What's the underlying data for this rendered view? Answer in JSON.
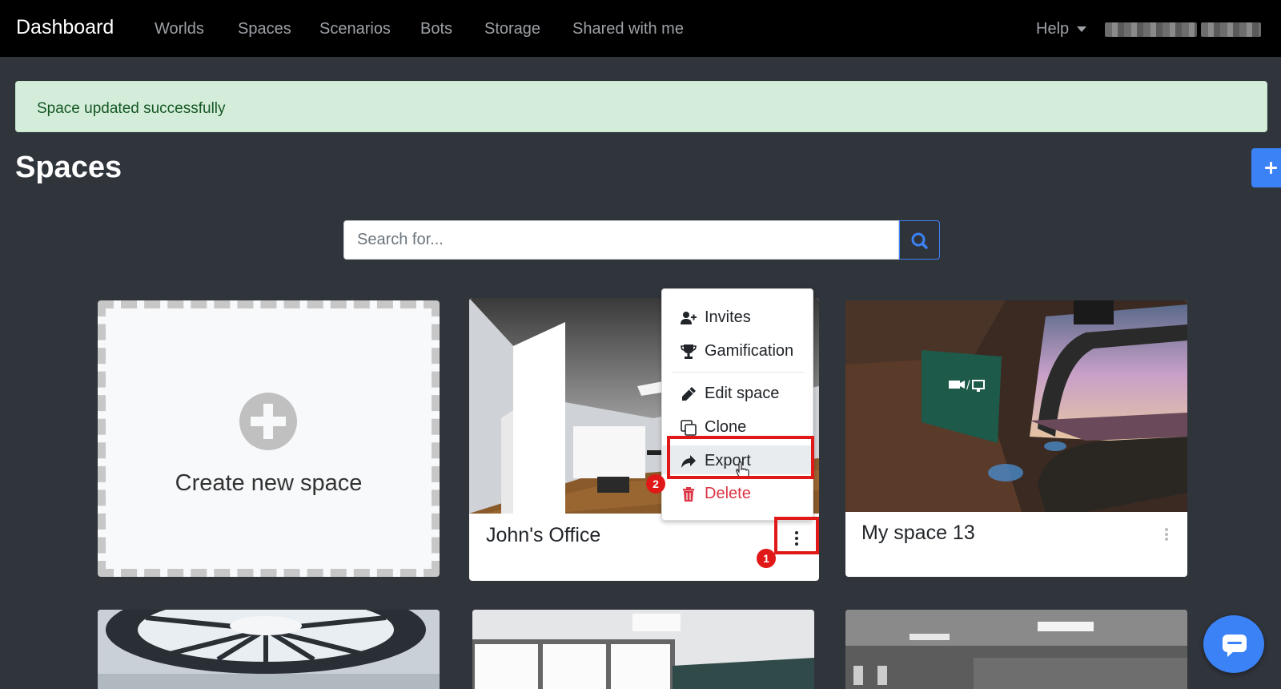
{
  "nav": {
    "brand": "Dashboard",
    "links": [
      "Worlds",
      "Spaces",
      "Scenarios",
      "Bots",
      "Storage",
      "Shared with me"
    ],
    "help": "Help"
  },
  "alert": {
    "text": "Space updated successfully"
  },
  "page": {
    "title": "Spaces"
  },
  "search": {
    "placeholder": "Search for..."
  },
  "create_card": {
    "label": "Create new space"
  },
  "spaces": [
    {
      "title": "John's Office"
    },
    {
      "title": "My space 13"
    }
  ],
  "menu": {
    "items": [
      "Invites",
      "Gamification",
      "Edit space",
      "Clone",
      "Export",
      "Delete"
    ],
    "highlighted": "Export"
  },
  "badges": [
    "1",
    "2"
  ],
  "colors": {
    "accent": "#3b82f6",
    "danger": "#dc3545",
    "highlight": "#e01818",
    "alert_bg": "#d4edda"
  }
}
